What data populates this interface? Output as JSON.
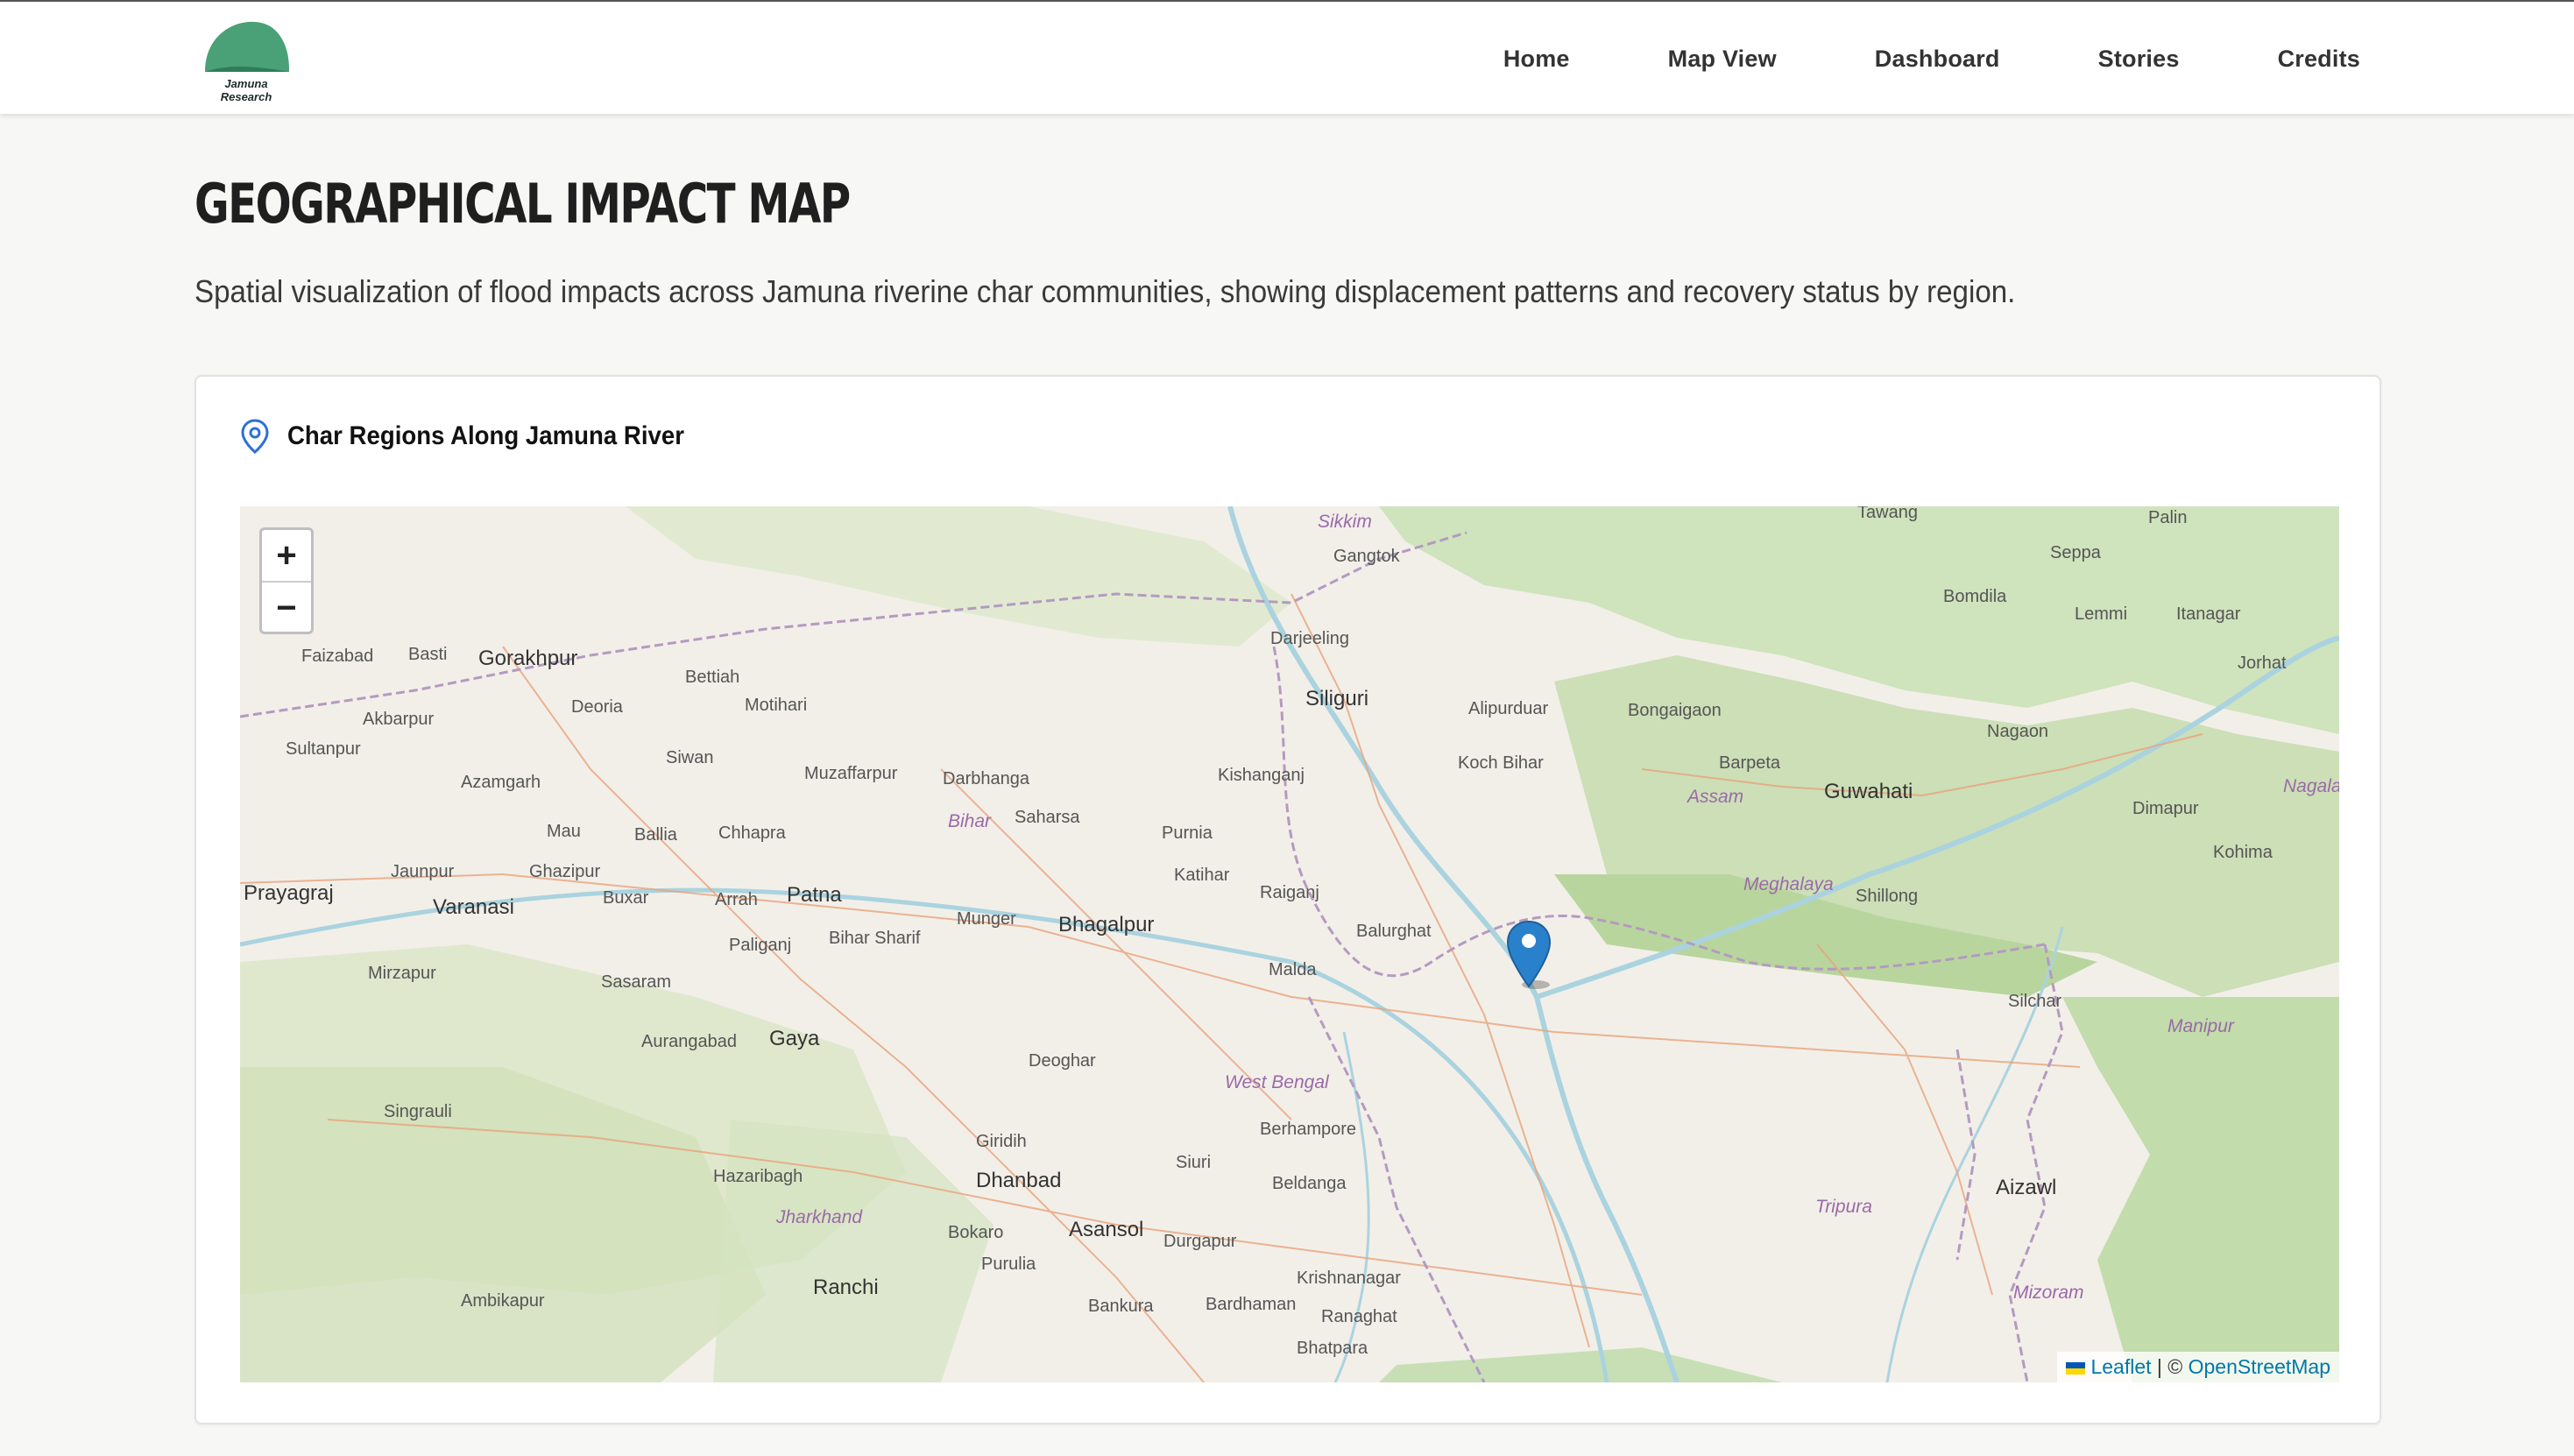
{
  "header": {
    "logo_text": "Jamuna Research",
    "nav": [
      "Home",
      "Map View",
      "Dashboard",
      "Stories",
      "Credits"
    ]
  },
  "page": {
    "title": "Geographical Impact Map",
    "description": "Spatial visualization of flood impacts across Jamuna riverine char communities, showing displacement patterns and recovery status by region."
  },
  "card": {
    "title": "Char Regions Along Jamuna River"
  },
  "map": {
    "zoom_in": "+",
    "zoom_out": "−",
    "attribution": {
      "leaflet": "Leaflet",
      "separator": " | © ",
      "osm": "OpenStreetMap"
    },
    "labels": [
      "Gorakhpur",
      "Faizabad",
      "Basti",
      "Akbarpur",
      "Sultanpur",
      "Deoria",
      "Motihari",
      "Bettiah",
      "Siwan",
      "Azamgarh",
      "Mau",
      "Ballia",
      "Chhapra",
      "Muzaffarpur",
      "Darbhanga",
      "Saharsa",
      "Purnia",
      "Kishanganj",
      "Siliguri",
      "Darjeeling",
      "Gangtok",
      "Sikkim",
      "Alipurduar",
      "Bongaigaon",
      "Koch Bihar",
      "Barpeta",
      "Guwahati",
      "Assam",
      "Nagaon",
      "Tawang",
      "Seppa",
      "Bomdila",
      "Lemmi",
      "Itanagar",
      "Palin",
      "Jorhat",
      "Dimapur",
      "Kohima",
      "Nagala",
      "Shillong",
      "Meghalaya",
      "Silchar",
      "Manipur",
      "Aizawl",
      "Mizoram",
      "Tripura",
      "Prayagraj",
      "Varanasi",
      "Jaunpur",
      "Ghazipur",
      "Buxar",
      "Arrah",
      "Patna",
      "Bihar Sharif",
      "Munger",
      "Bhagalpur",
      "Katihar",
      "Raiganj",
      "Balurghat",
      "Malda",
      "Mirzapur",
      "Sasaram",
      "Aurangabad",
      "Gaya",
      "Deoghar",
      "Singrauli",
      "Hazaribagh",
      "Dhanbad",
      "Giridih",
      "Jharkhand",
      "Bokaro",
      "Asansol",
      "Durgapur",
      "Purulia",
      "Ranchi",
      "Bankura",
      "Bardhaman",
      "Berhampore",
      "Beldanga",
      "Krishnanagar",
      "Ranaghat",
      "Bhatpara",
      "Ambikapur",
      "West Bengal",
      "Siuri",
      "Bihar",
      "Paliganj",
      "Prayagraj"
    ]
  },
  "colors": {
    "logo_green": "#3f9b6e",
    "pin_blue": "#2f6fd4",
    "marker_blue": "#2a81cb",
    "forest": "#c8dfb5",
    "water": "#aad3df",
    "border": "#b49ac0"
  }
}
